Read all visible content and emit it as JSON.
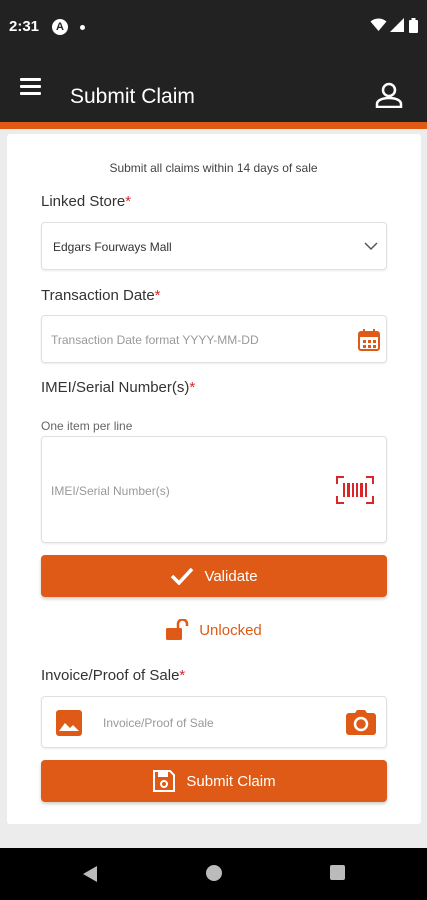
{
  "status_bar": {
    "time": "2:31",
    "notification_icon": "A"
  },
  "app_bar": {
    "title": "Submit Claim"
  },
  "form": {
    "hint": "Submit all claims within 14 days of sale",
    "linked_store": {
      "label": "Linked Store",
      "required": "*",
      "value": "Edgars Fourways Mall"
    },
    "transaction_date": {
      "label": "Transaction Date",
      "required": "*",
      "placeholder": "Transaction Date format YYYY-MM-DD"
    },
    "imei": {
      "label": "IMEI/Serial Number(s)",
      "required": "*",
      "sublabel": "One item per line",
      "placeholder": "IMEI/Serial Number(s)"
    },
    "validate_button": "Validate",
    "lock_status": "Unlocked",
    "invoice": {
      "label": "Invoice/Proof of Sale",
      "required": "*",
      "placeholder": "Invoice/Proof of Sale"
    },
    "submit_button": "Submit Claim"
  },
  "colors": {
    "accent": "#de5a16",
    "app_bar": "#222222",
    "required": "#d9262a"
  },
  "icons": [
    "menu-icon",
    "profile-icon",
    "chevron-down-icon",
    "calendar-icon",
    "barcode-icon",
    "check-icon",
    "unlock-icon",
    "image-icon",
    "camera-icon",
    "save-icon"
  ]
}
